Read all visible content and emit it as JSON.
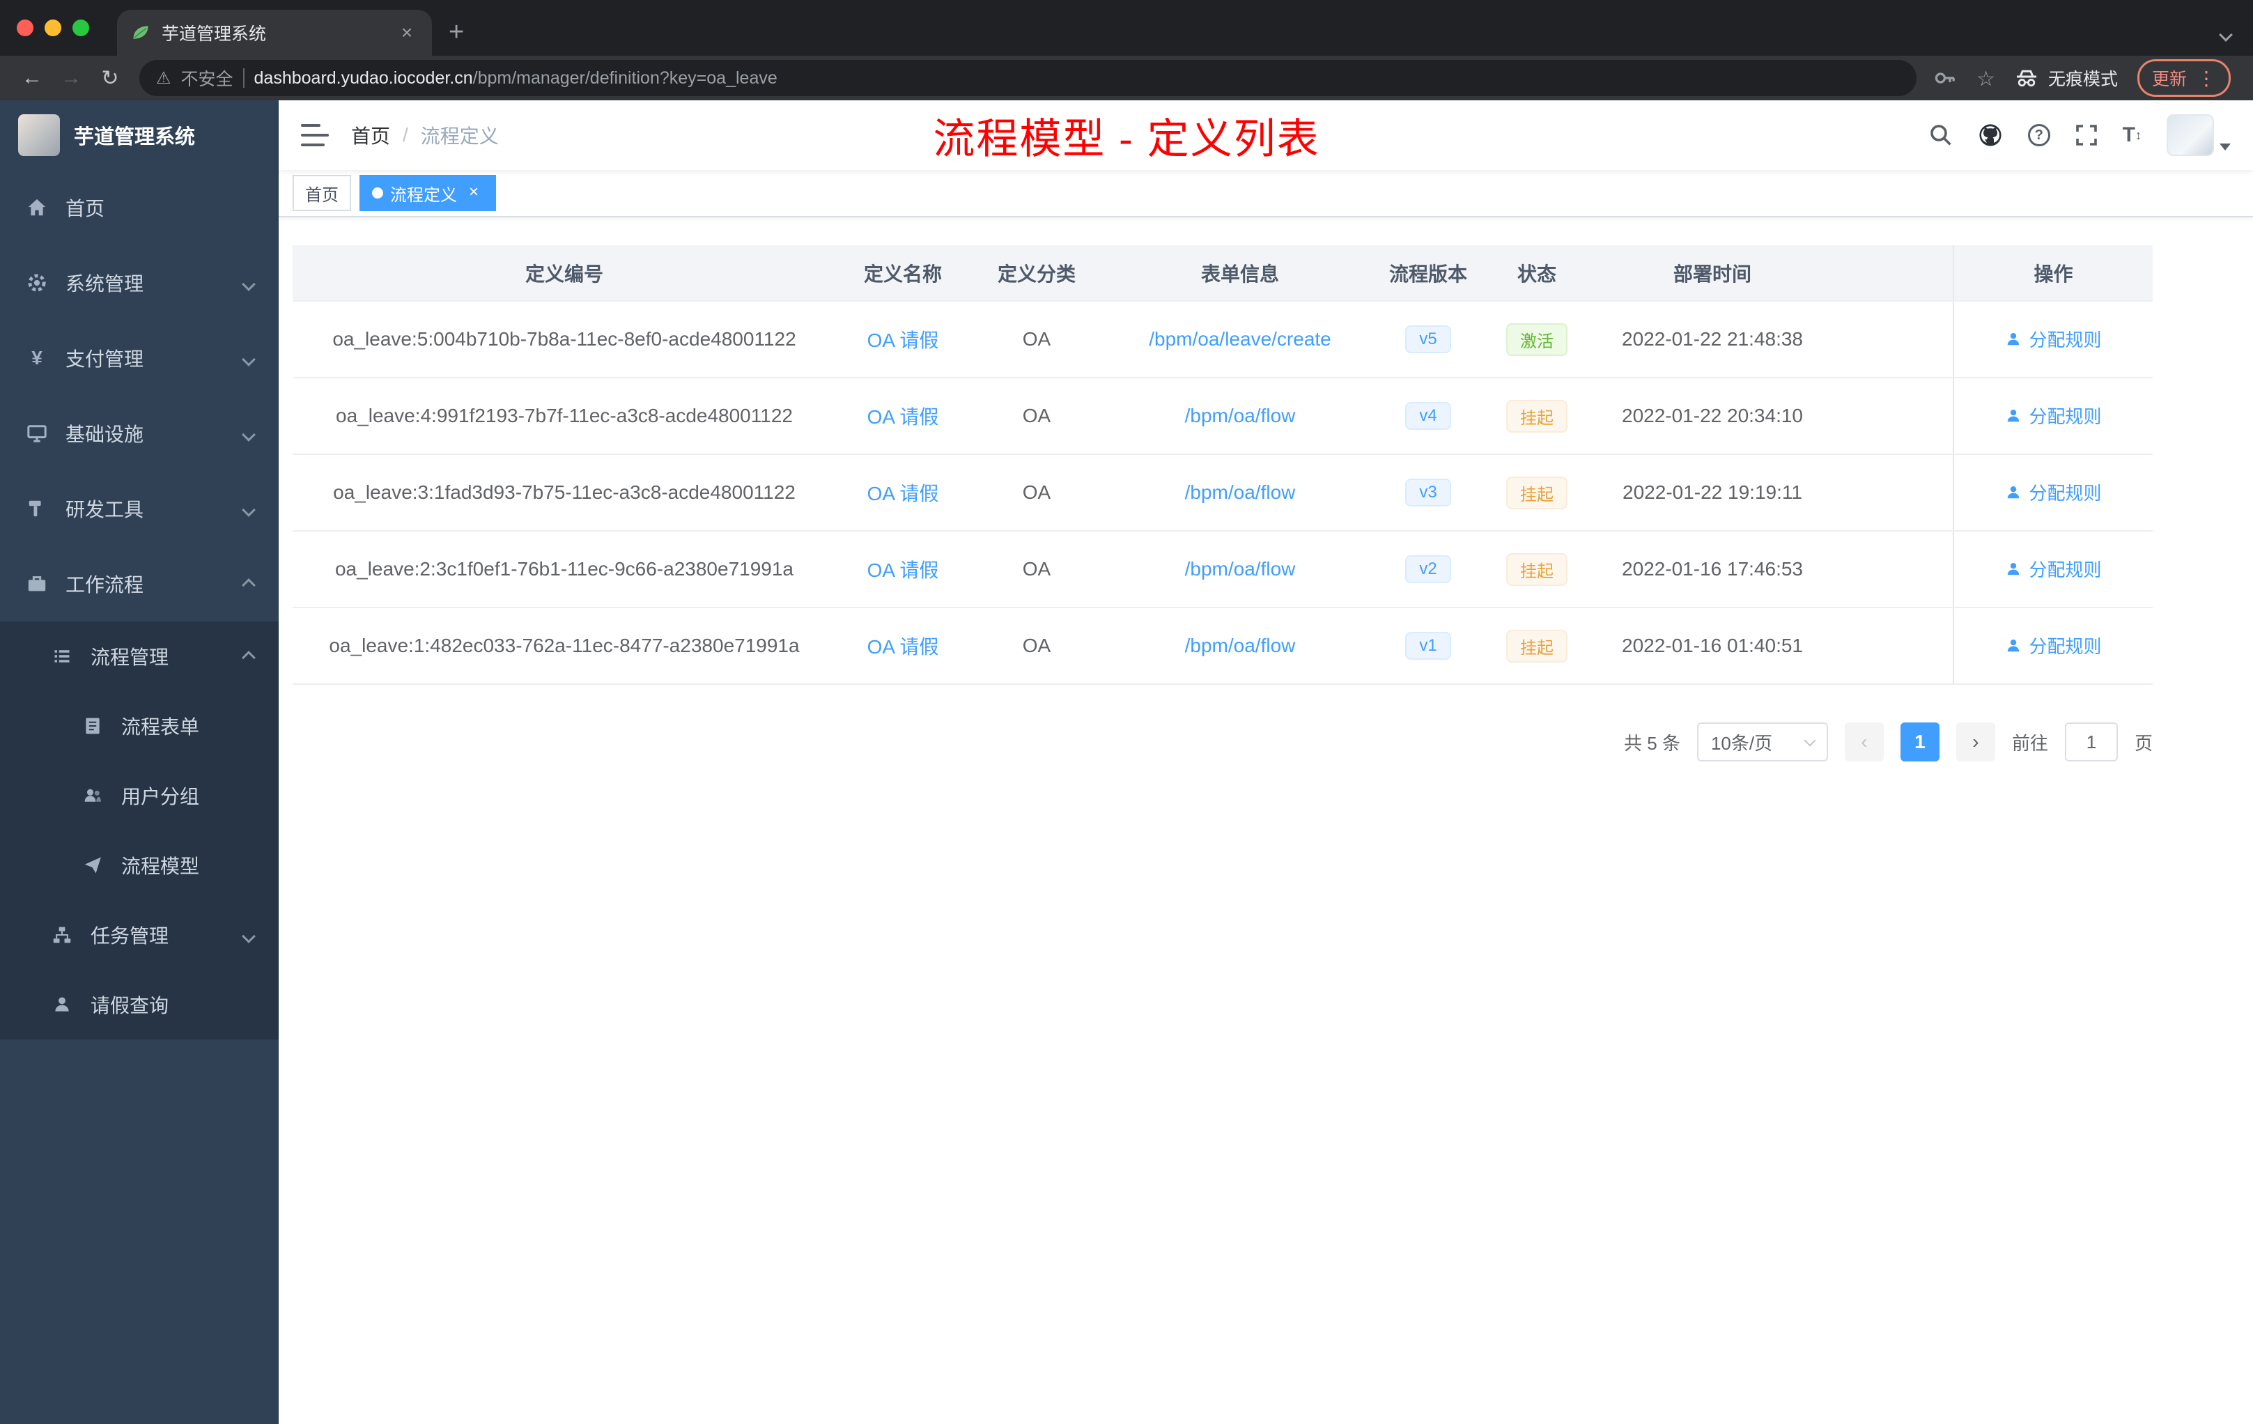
{
  "browser": {
    "tab_title": "芋道管理系统",
    "security_label": "不安全",
    "url_domain": "dashboard.yudao.iocoder.cn",
    "url_path": "/bpm/manager/definition?key=oa_leave",
    "incognito_label": "无痕模式",
    "update_label": "更新"
  },
  "sidebar": {
    "logo_title": "芋道管理系统",
    "menu": [
      {
        "label": "首页"
      },
      {
        "label": "系统管理"
      },
      {
        "label": "支付管理"
      },
      {
        "label": "基础设施"
      },
      {
        "label": "研发工具"
      },
      {
        "label": "工作流程"
      },
      {
        "label": "流程管理"
      },
      {
        "label": "流程表单"
      },
      {
        "label": "用户分组"
      },
      {
        "label": "流程模型"
      },
      {
        "label": "任务管理"
      },
      {
        "label": "请假查询"
      }
    ]
  },
  "header": {
    "breadcrumb_home": "首页",
    "breadcrumb_sep": "/",
    "breadcrumb_current": "流程定义",
    "annotation": "流程模型 - 定义列表"
  },
  "tags": {
    "home": "首页",
    "active": "流程定义"
  },
  "table": {
    "columns": [
      "定义编号",
      "定义名称",
      "定义分类",
      "表单信息",
      "流程版本",
      "状态",
      "部署时间",
      "操作"
    ],
    "rows": [
      {
        "id": "oa_leave:5:004b710b-7b8a-11ec-8ef0-acde48001122",
        "name": "OA 请假",
        "category": "OA",
        "form": "/bpm/oa/leave/create",
        "version": "v5",
        "status": "激活",
        "time": "2022-01-22 21:48:38",
        "action": "分配规则"
      },
      {
        "id": "oa_leave:4:991f2193-7b7f-11ec-a3c8-acde48001122",
        "name": "OA 请假",
        "category": "OA",
        "form": "/bpm/oa/flow",
        "version": "v4",
        "status": "挂起",
        "time": "2022-01-22 20:34:10",
        "action": "分配规则"
      },
      {
        "id": "oa_leave:3:1fad3d93-7b75-11ec-a3c8-acde48001122",
        "name": "OA 请假",
        "category": "OA",
        "form": "/bpm/oa/flow",
        "version": "v3",
        "status": "挂起",
        "time": "2022-01-22 19:19:11",
        "action": "分配规则"
      },
      {
        "id": "oa_leave:2:3c1f0ef1-76b1-11ec-9c66-a2380e71991a",
        "name": "OA 请假",
        "category": "OA",
        "form": "/bpm/oa/flow",
        "version": "v2",
        "status": "挂起",
        "time": "2022-01-16 17:46:53",
        "action": "分配规则"
      },
      {
        "id": "oa_leave:1:482ec033-762a-11ec-8477-a2380e71991a",
        "name": "OA 请假",
        "category": "OA",
        "form": "/bpm/oa/flow",
        "version": "v1",
        "status": "挂起",
        "time": "2022-01-16 01:40:51",
        "action": "分配规则"
      }
    ]
  },
  "pagination": {
    "total": "共 5 条",
    "page_size": "10条/页",
    "current_page": "1",
    "goto_label": "前往",
    "goto_value": "1",
    "page_unit": "页"
  },
  "colors": {
    "accent": "#409eff",
    "success": "#67c23a",
    "warning": "#e6a23c",
    "annotation_red": "#ff0000",
    "sidebar_bg": "#304156"
  },
  "icons": {
    "tab_favicon": "leaf",
    "security": "warning-triangle",
    "status_tags": "rounded-pill",
    "action": "user-silhouette",
    "pager_prev": "‹",
    "pager_next": "›"
  }
}
